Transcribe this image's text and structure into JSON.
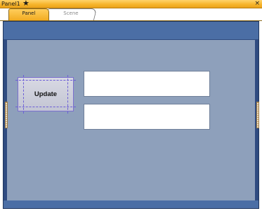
{
  "window": {
    "title": "Panel1",
    "modified_marker": "★",
    "close_glyph": "×"
  },
  "tabs": [
    {
      "label": "Panel",
      "active": true
    },
    {
      "label": "Scene",
      "active": false
    }
  ],
  "panel": {
    "update_button_label": "Update",
    "field_1": {
      "value": "",
      "placeholder": ""
    },
    "field_2": {
      "value": "",
      "placeholder": ""
    }
  },
  "colors": {
    "title_bar": "#f6b328",
    "active_tab": "#f2ac22",
    "outer_frame": "#2f4b80",
    "frame_bar": "#4b6ea5",
    "panel_background": "#8ea0bb",
    "button_face": "#c3c5d3",
    "selection_guides": "#6b5ed6"
  },
  "icons": {
    "close": "close-icon",
    "modified": "star-icon",
    "left_handle": "resize-handle-icon",
    "right_handle": "resize-handle-icon"
  }
}
